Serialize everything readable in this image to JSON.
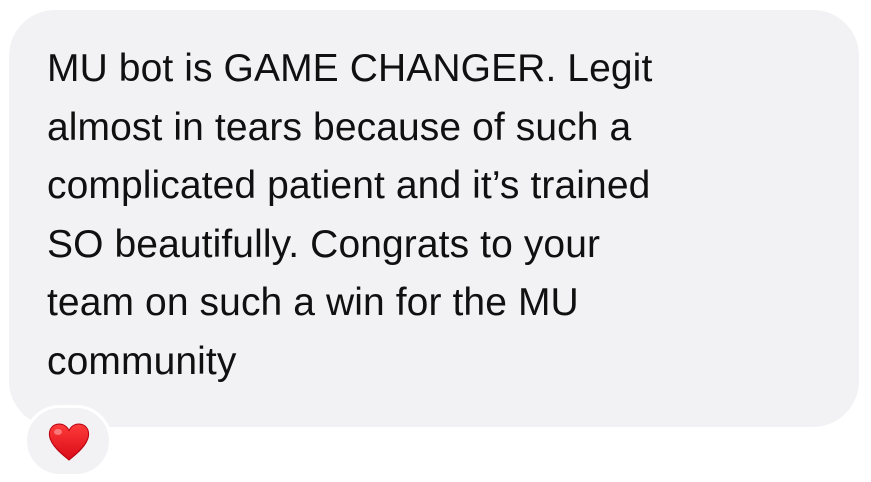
{
  "message": {
    "lines": [
      "MU bot is GAME CHANGER. Legit",
      "almost in tears because of such a",
      "complicated patient and it’s trained",
      "SO beautifully. Congrats to your",
      "team on such a win for the MU",
      "community"
    ]
  },
  "reaction": {
    "icon": "heart-icon",
    "color": "#e0121e"
  },
  "colors": {
    "bubble": "#f2f2f5",
    "text": "#101010",
    "background": "#ffffff"
  }
}
